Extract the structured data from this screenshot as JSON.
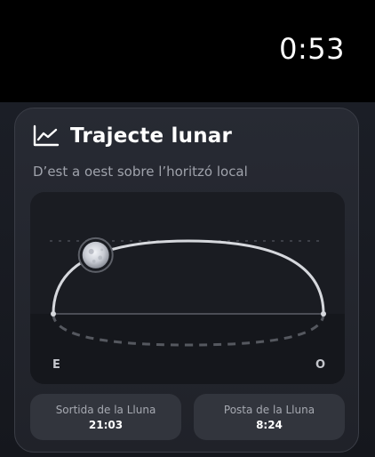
{
  "status_bar": {
    "time": "0:53"
  },
  "card": {
    "icon": "line-chart-icon",
    "title": "Trajecte lunar",
    "subtitle": "D’est a oest sobre l’horitzó local",
    "path": {
      "moon_icon": "moon-icon",
      "east_label": "E",
      "west_label": "O",
      "moon_progress": 0.28
    },
    "moonrise": {
      "label": "Sortida de la Lluna",
      "value": "21:03"
    },
    "moonset": {
      "label": "Posta de la Lluna",
      "value": "8:24"
    }
  }
}
